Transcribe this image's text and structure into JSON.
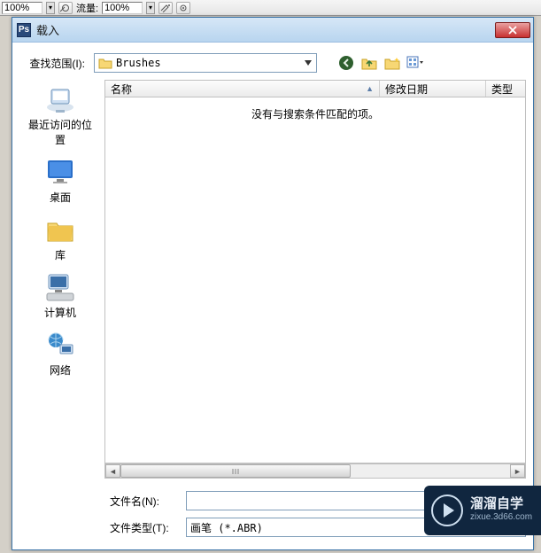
{
  "toolbar": {
    "opacity_value": "100%",
    "flow_label": "流量:",
    "flow_value": "100%"
  },
  "dialog": {
    "app_icon": "Ps",
    "title": "载入",
    "lookin_label": "查找范围(I):",
    "lookin_value": "Brushes",
    "columns": {
      "name": "名称",
      "date": "修改日期",
      "type": "类型"
    },
    "empty_message": "没有与搜索条件匹配的项。",
    "places": [
      {
        "key": "recent",
        "label": "最近访问的位置"
      },
      {
        "key": "desktop",
        "label": "桌面"
      },
      {
        "key": "libraries",
        "label": "库"
      },
      {
        "key": "computer",
        "label": "计算机"
      },
      {
        "key": "network",
        "label": "网络"
      }
    ],
    "filename_label": "文件名(N):",
    "filename_value": "",
    "filetype_label": "文件类型(T):",
    "filetype_value": "画笔 (*.ABR)"
  },
  "watermark": {
    "main": "溜溜自学",
    "sub": "zixue.3d66.com"
  }
}
